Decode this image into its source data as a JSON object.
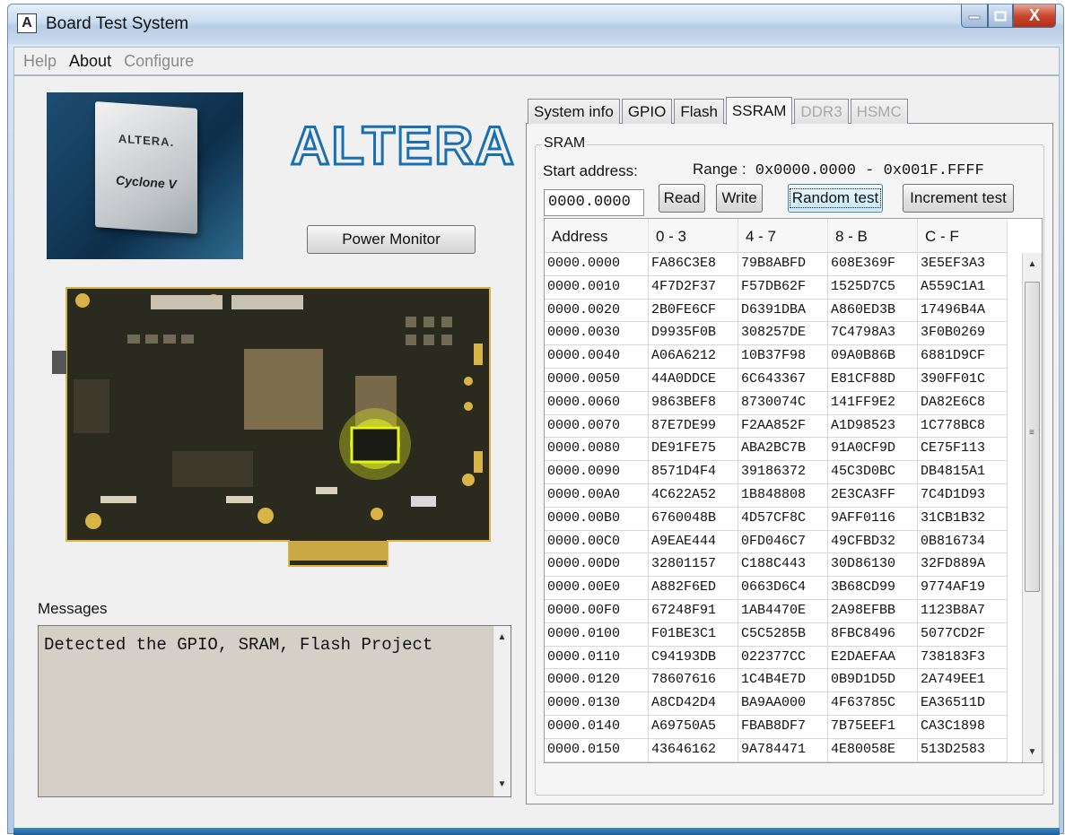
{
  "window": {
    "title": "Board Test System",
    "icon_glyph": "A",
    "close_glyph": "X"
  },
  "menu": {
    "items": [
      "Help",
      "About",
      "Configure"
    ]
  },
  "chip": {
    "brand": "ALTERA.",
    "family": "Cyclone V"
  },
  "logo": {
    "text": "ALTERA"
  },
  "power_monitor": {
    "label": "Power Monitor"
  },
  "messages": {
    "label": "Messages",
    "text": "Detected the GPIO, SRAM, Flash Project",
    "scroll_up": "▲",
    "scroll_down": "▼"
  },
  "tabs": [
    {
      "label": "System info",
      "state": "normal"
    },
    {
      "label": "GPIO",
      "state": "normal"
    },
    {
      "label": "Flash",
      "state": "normal"
    },
    {
      "label": "SSRAM",
      "state": "active"
    },
    {
      "label": "DDR3",
      "state": "disabled"
    },
    {
      "label": "HSMC",
      "state": "disabled"
    }
  ],
  "sram": {
    "group_label": "SRAM",
    "start_label": "Start address:",
    "range_label": "Range :",
    "range_value": "0x0000.0000 - 0x001F.FFFF",
    "start_value": "0000.0000",
    "buttons": {
      "read": "Read",
      "write": "Write",
      "random": "Random test",
      "increment": "Increment test"
    },
    "columns": [
      "Address",
      "0 - 3",
      "4 - 7",
      "8 - B",
      "C - F"
    ],
    "rows": [
      [
        "0000.0000",
        "FA86C3E8",
        "79B8ABFD",
        "608E369F",
        "3E5EF3A3"
      ],
      [
        "0000.0010",
        "4F7D2F37",
        "F57DB62F",
        "1525D7C5",
        "A559C1A1"
      ],
      [
        "0000.0020",
        "2B0FE6CF",
        "D6391DBA",
        "A860ED3B",
        "17496B4A"
      ],
      [
        "0000.0030",
        "D9935F0B",
        "308257DE",
        "7C4798A3",
        "3F0B0269"
      ],
      [
        "0000.0040",
        "A06A6212",
        "10B37F98",
        "09A0B86B",
        "6881D9CF"
      ],
      [
        "0000.0050",
        "44A0DDCE",
        "6C643367",
        "E81CF88D",
        "390FF01C"
      ],
      [
        "0000.0060",
        "9863BEF8",
        "8730074C",
        "141FF9E2",
        "DA82E6C8"
      ],
      [
        "0000.0070",
        "87E7DE99",
        "F2AA852F",
        "A1D98523",
        "1C778BC8"
      ],
      [
        "0000.0080",
        "DE91FE75",
        "ABA2BC7B",
        "91A0CF9D",
        "CE75F113"
      ],
      [
        "0000.0090",
        "8571D4F4",
        "39186372",
        "45C3D0BC",
        "DB4815A1"
      ],
      [
        "0000.00A0",
        "4C622A52",
        "1B848808",
        "2E3CA3FF",
        "7C4D1D93"
      ],
      [
        "0000.00B0",
        "6760048B",
        "4D57CF8C",
        "9AFF0116",
        "31CB1B32"
      ],
      [
        "0000.00C0",
        "A9EAE444",
        "0FD046C7",
        "49CFBD32",
        "0B816734"
      ],
      [
        "0000.00D0",
        "32801157",
        "C188C443",
        "30D86130",
        "32FD889A"
      ],
      [
        "0000.00E0",
        "A882F6ED",
        "0663D6C4",
        "3B68CD99",
        "9774AF19"
      ],
      [
        "0000.00F0",
        "67248F91",
        "1AB4470E",
        "2A98EFBB",
        "1123B8A7"
      ],
      [
        "0000.0100",
        "F01BE3C1",
        "C5C5285B",
        "8FBC8496",
        "5077CD2F"
      ],
      [
        "0000.0110",
        "C94193DB",
        "022377CC",
        "E2DAEFAA",
        "738183F3"
      ],
      [
        "0000.0120",
        "78607616",
        "1C4B4E7D",
        "0B9D1D5D",
        "2A749EE1"
      ],
      [
        "0000.0130",
        "A8CD42D4",
        "BA9AA000",
        "4F63785C",
        "EA36511D"
      ],
      [
        "0000.0140",
        "A69750A5",
        "FBAB8DF7",
        "7B75EEF1",
        "CA3C1898"
      ],
      [
        "0000.0150",
        "43646162",
        "9A784471",
        "4E80058E",
        "513D2583"
      ]
    ],
    "scroll_grip": "≡"
  },
  "colors": {
    "highlight": "#e4f21e",
    "board": "#2b2a1f",
    "gold": "#d8b446"
  }
}
